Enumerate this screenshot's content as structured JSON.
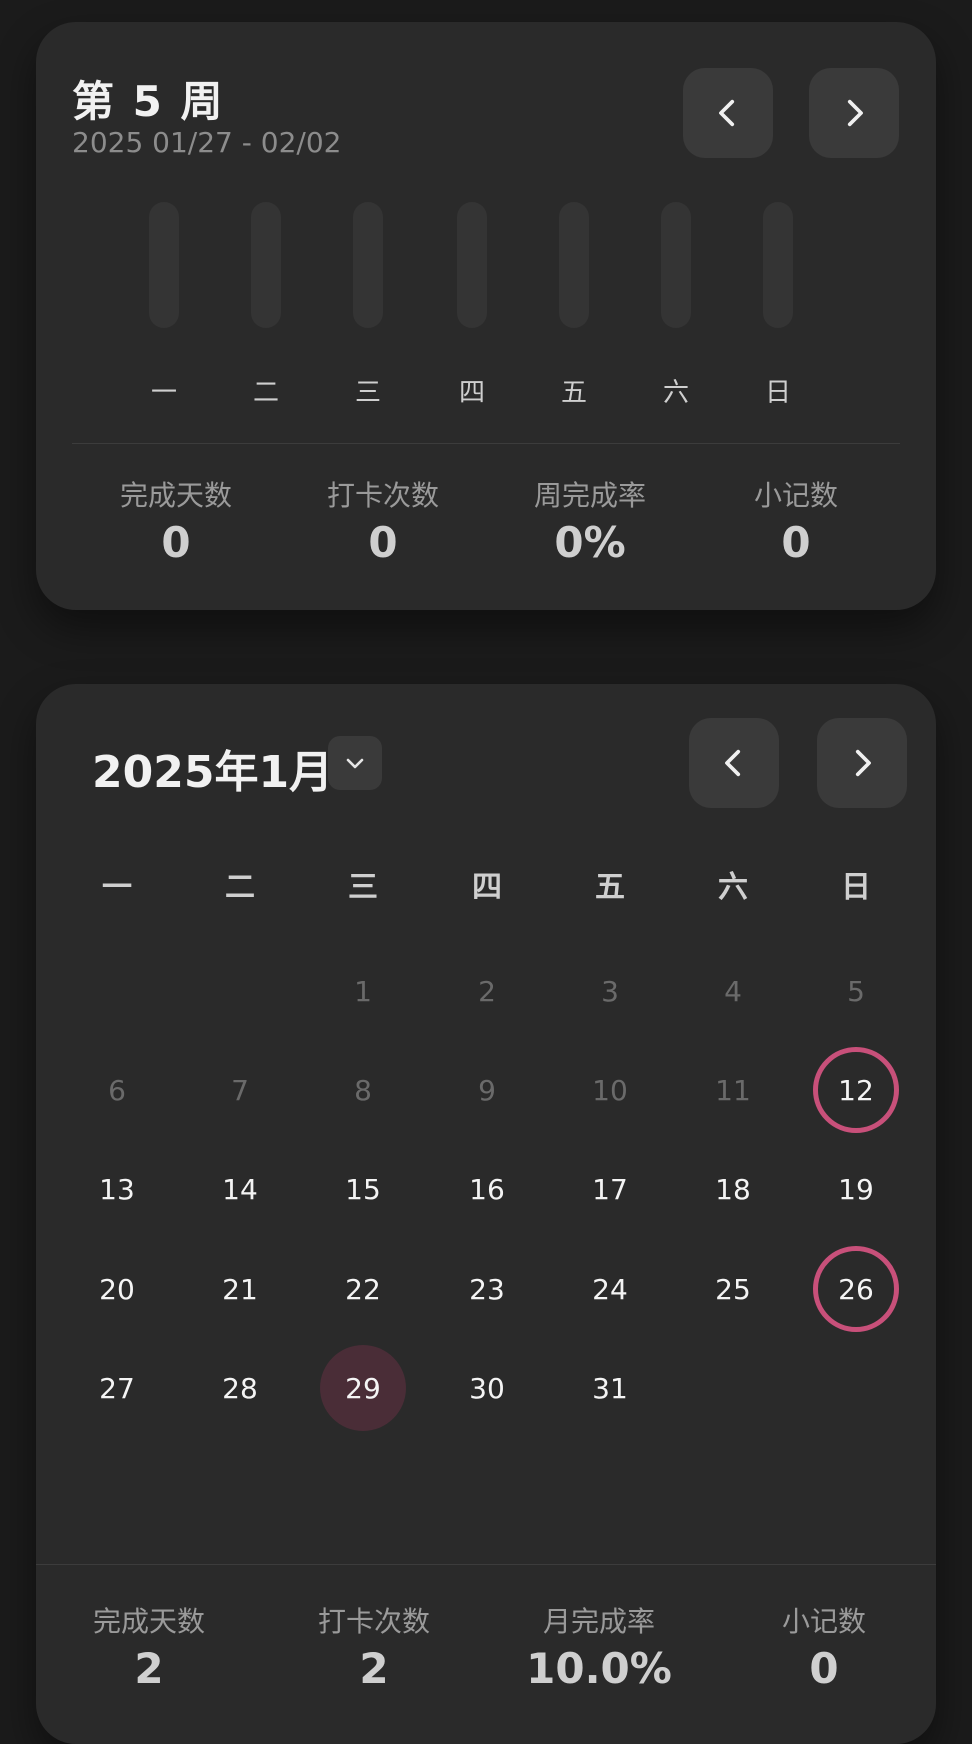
{
  "week": {
    "title": "第 5 周",
    "range": "2025 01/27 - 02/02",
    "days": [
      {
        "label": "一",
        "progress": 0
      },
      {
        "label": "二",
        "progress": 0
      },
      {
        "label": "三",
        "progress": 0
      },
      {
        "label": "四",
        "progress": 0
      },
      {
        "label": "五",
        "progress": 0
      },
      {
        "label": "六",
        "progress": 0
      },
      {
        "label": "日",
        "progress": 0
      }
    ],
    "stats": [
      {
        "label": "完成天数",
        "value": "0"
      },
      {
        "label": "打卡次数",
        "value": "0"
      },
      {
        "label": "周完成率",
        "value": "0%"
      },
      {
        "label": "小记数",
        "value": "0"
      }
    ]
  },
  "month": {
    "title": "2025年1月",
    "weekday_headers": [
      "一",
      "二",
      "三",
      "四",
      "五",
      "六",
      "日"
    ],
    "weeks": [
      [
        "",
        "",
        "1",
        "2",
        "3",
        "4",
        "5"
      ],
      [
        "6",
        "7",
        "8",
        "9",
        "10",
        "11",
        "12"
      ],
      [
        "13",
        "14",
        "15",
        "16",
        "17",
        "18",
        "19"
      ],
      [
        "20",
        "21",
        "22",
        "23",
        "24",
        "25",
        "26"
      ],
      [
        "27",
        "28",
        "29",
        "30",
        "31",
        "",
        ""
      ]
    ],
    "dim_before": 12,
    "checked_days": [
      12,
      26
    ],
    "today": 29,
    "stats": [
      {
        "label": "完成天数",
        "value": "2"
      },
      {
        "label": "打卡次数",
        "value": "2"
      },
      {
        "label": "月完成率",
        "value": "10.0%"
      },
      {
        "label": "小记数",
        "value": "0"
      }
    ]
  },
  "icons": {
    "prev": "chevron-left-icon",
    "next": "chevron-right-icon",
    "dropdown": "chevron-down-icon"
  },
  "colors": {
    "accent": "#c8507a",
    "today_fill": "#4a2d37",
    "card": "#2a2a2a",
    "background": "#1b1b1b"
  }
}
